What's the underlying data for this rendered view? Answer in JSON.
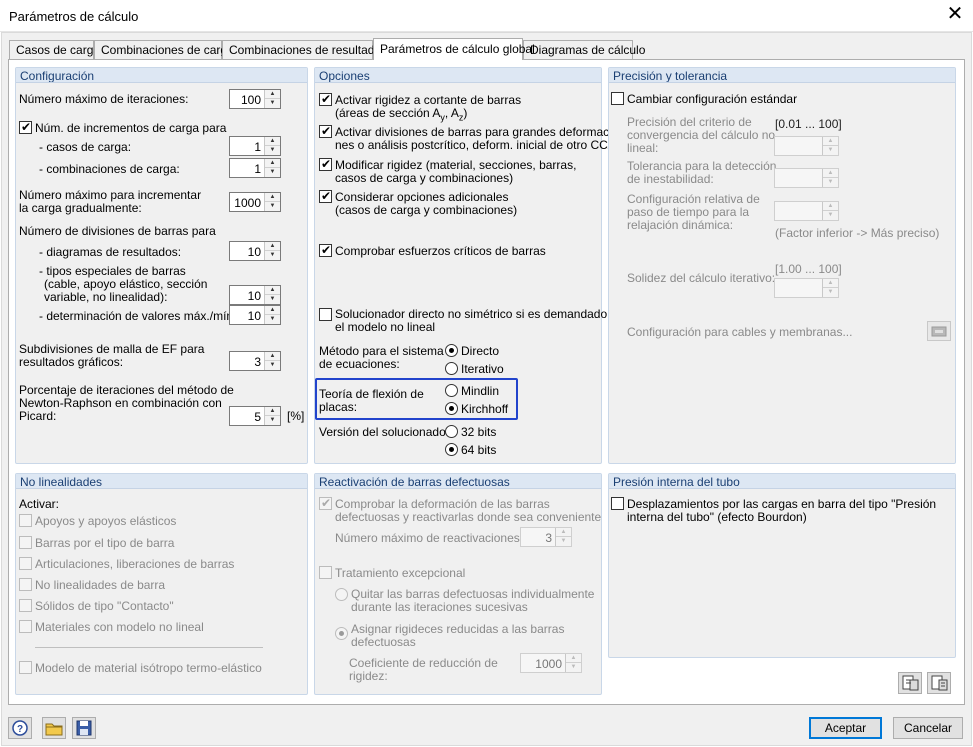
{
  "window": {
    "title": "Parámetros de cálculo"
  },
  "tabs": [
    "Casos de carga",
    "Combinaciones de carga",
    "Combinaciones de resultados",
    "Parámetros de cálculo global",
    "Diagramas de cálculo"
  ],
  "config": {
    "header": "Configuración",
    "max_iter_label": "Número máximo de iteraciones:",
    "max_iter": "100",
    "load_incr_label": "Núm. de incrementos de carga para",
    "load_cases_label": "- casos de carga:",
    "load_cases": "1",
    "load_combos_label": "- combinaciones de carga:",
    "load_combos": "1",
    "max_grad_label_1": "Número máximo para incrementar",
    "max_grad_label_2": "la carga gradualmente:",
    "max_grad": "1000",
    "divisions_label": "Número de divisiones de barras para",
    "result_diag_label": "- diagramas de resultados:",
    "result_diag": "10",
    "special_label_1": "- tipos especiales de barras",
    "special_label_2": "(cable, apoyo elástico, sección",
    "special_label_3": "variable, no linealidad):",
    "special": "10",
    "maxmin_label": "- determinación de valores máx./mín.:",
    "maxmin": "10",
    "mesh_label_1": "Subdivisiones de malla de EF para",
    "mesh_label_2": "resultados gráficos:",
    "mesh": "3",
    "percent_label_1": "Porcentaje de iteraciones del método de",
    "percent_label_2": "Newton-Raphson en combinación con",
    "percent_label_3": "Picard:",
    "percent": "5",
    "percent_unit": "[%]"
  },
  "options": {
    "header": "Opciones",
    "shear_1": "Activar rigidez a cortante de barras",
    "shear_2": "(áreas de sección A",
    "shear_sub_y": "y",
    "shear_mid": ", A",
    "shear_sub_z": "z",
    "shear_end": ")",
    "div_1": "Activar divisiones de barras para grandes deformacio-",
    "div_2": "nes o análisis postcrítico, deform. inicial de otro CC/CO",
    "modify_1": "Modificar rigidez (material, secciones, barras,",
    "modify_2": "casos de carga y combinaciones)",
    "extra_1": "Considerar opciones adicionales",
    "extra_2": "(casos de carga y combinaciones)",
    "critical": "Comprobar esfuerzos críticos de barras",
    "solver_ns_1": "Solucionador directo no simétrico si es demandado por",
    "solver_ns_2": "el modelo no lineal",
    "method_label_1": "Método para el sistema",
    "method_label_2": "de ecuaciones:",
    "method_direct": "Directo",
    "method_iter": "Iterativo",
    "plate_label_1": "Teoría de flexión de",
    "plate_label_2": "placas:",
    "plate_mindlin": "Mindlin",
    "plate_kirchhoff": "Kirchhoff",
    "version_label": "Versión del solucionador:",
    "v32": "32 bits",
    "v64": "64 bits"
  },
  "precision": {
    "header": "Precisión y tolerancia",
    "change_std": "Cambiar configuración estándar",
    "conv_1": "Precisión del criterio de",
    "conv_2": "convergencia del cálculo no",
    "conv_3": "lineal:",
    "conv_range": "[0.01 ... 100]",
    "tol_1": "Tolerancia para la detección",
    "tol_2": "de inestabilidad:",
    "relax_1": "Configuración relativa de",
    "relax_2": "paso de tiempo para la",
    "relax_3": "relajación dinámica:",
    "factor_note": "(Factor inferior -> Más preciso)",
    "solid_label": "Solidez del cálculo iterativo:",
    "solid_range": "[1.00 ... 100]",
    "cables": "Configuración para cables y membranas..."
  },
  "nonlin": {
    "header": "No linealidades",
    "activate": "Activar:",
    "items": [
      "Apoyos y apoyos elásticos",
      "Barras por el tipo de barra",
      "Articulaciones, liberaciones de barras",
      "No linealidades de barra",
      "Sólidos de tipo \"Contacto\"",
      "Materiales con modelo no lineal"
    ],
    "thermo": "Modelo de material isótropo termo-elástico"
  },
  "reactivation": {
    "header": "Reactivación de barras defectuosas",
    "check_1": "Comprobar la deformación de las barras",
    "check_2": "defectuosas y reactivarlas donde sea conveniente",
    "max_react_label": "Número máximo de reactivaciones:",
    "max_react": "3",
    "exceptional": "Tratamiento excepcional",
    "remove_1": "Quitar las barras defectuosas individualmente",
    "remove_2": "durante las iteraciones sucesivas",
    "assign_1": "Asignar rigideces reducidas a las barras",
    "assign_2": "defectuosas",
    "coef_1": "Coeficiente de reducción de",
    "coef_2": "rigidez:",
    "coef": "1000"
  },
  "pipe": {
    "header": "Presión interna del tubo",
    "disp_1": "Desplazamientos por las cargas en barra del tipo \"Presión",
    "disp_2": "interna del tubo\" (efecto Bourdon)"
  },
  "footer": {
    "ok": "Aceptar",
    "cancel": "Cancelar"
  }
}
